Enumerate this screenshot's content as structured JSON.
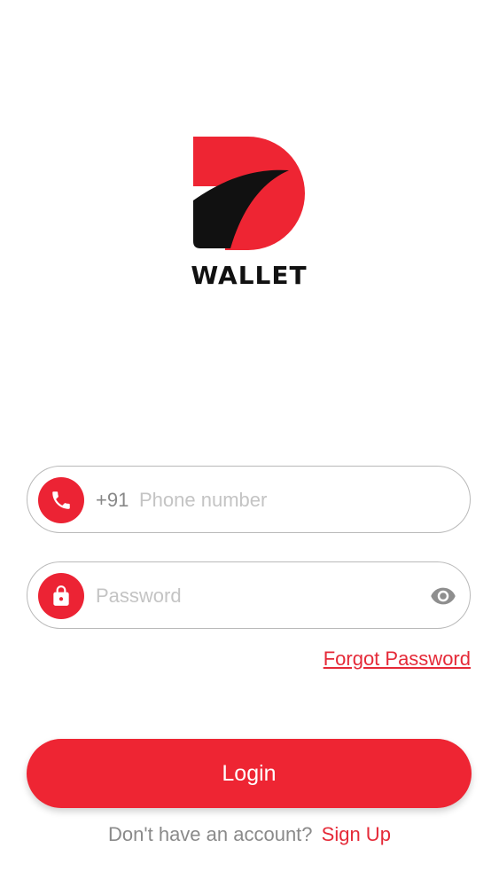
{
  "brand": {
    "logo_text": "WALLET",
    "primary_color": "#ee2533",
    "dark_color": "#111111"
  },
  "phone_field": {
    "icon": "phone-icon",
    "prefix": "+91",
    "placeholder": "Phone number",
    "value": ""
  },
  "password_field": {
    "icon": "lock-icon",
    "placeholder": "Password",
    "value": "",
    "toggle_icon": "eye-icon"
  },
  "forgot_password_label": "Forgot Password",
  "login_label": "Login",
  "signup": {
    "prompt": "Don't have an account?",
    "link_label": "Sign Up"
  }
}
